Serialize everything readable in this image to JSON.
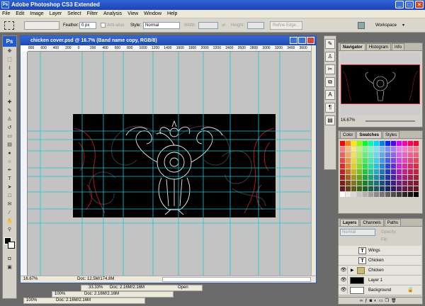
{
  "app": {
    "title": "Adobe Photoshop CS3 Extended",
    "logo": "Ps"
  },
  "menu": [
    "File",
    "Edit",
    "Image",
    "Layer",
    "Select",
    "Filter",
    "Analysis",
    "View",
    "Window",
    "Help"
  ],
  "options": {
    "feather_label": "Feather:",
    "feather_value": "0 px",
    "anti_alias": "Anti-alias",
    "style_label": "Style:",
    "style_value": "Normal",
    "width_label": "Width:",
    "height_label": "Height:",
    "refine_edge": "Refine Edge...",
    "workspace": "Workspace"
  },
  "document": {
    "title": "chicken cover.psd @ 16.7% (Band name copy, RGB/8)",
    "zoom": "16.67%",
    "doc_info": "Doc: 12.5M/174.8M",
    "ruler_ticks": [
      "800",
      "600",
      "400",
      "200",
      "0",
      "200",
      "400",
      "600",
      "800",
      "1000",
      "1200",
      "1400",
      "1600",
      "1800",
      "2000",
      "2200",
      "2400",
      "2600",
      "2800",
      "3000",
      "3200",
      "3400",
      "3600"
    ]
  },
  "minimized_docs": [
    {
      "zoom": "33.33%",
      "doc": "Doc: 2.16M/2.16M",
      "extra": "Open"
    },
    {
      "zoom": "100%",
      "doc": "Doc: 2.16M/2.16M"
    },
    {
      "zoom": "100%",
      "doc": "Doc: 2.16M/2.16M"
    }
  ],
  "navigator": {
    "tabs": [
      "Navigator",
      "Histogram",
      "Info"
    ],
    "zoom": "16.67%"
  },
  "color_panel": {
    "tabs": [
      "Color",
      "Swatches",
      "Styles"
    ]
  },
  "layers_panel": {
    "tabs": [
      "Layers",
      "Channels",
      "Paths"
    ],
    "blend_mode": "Normal",
    "opacity_label": "Opacity:",
    "fill_label": "Fill:",
    "layers": [
      {
        "name": "Wings",
        "kind": "text"
      },
      {
        "name": "Chicken",
        "kind": "text"
      },
      {
        "name": "Chicken",
        "kind": "group"
      },
      {
        "name": "Layer 1",
        "kind": "pixel"
      },
      {
        "name": "Background",
        "kind": "background"
      }
    ]
  },
  "colors": {
    "titlebar": "#1a44b4",
    "canvas_bg": "#c3c3c3",
    "guide": "#19c6d6",
    "art_red": "#b3141f",
    "art_white": "#ffffff"
  },
  "icons": [
    "marquee-icon",
    "move-icon",
    "lasso-icon",
    "magic-wand-icon",
    "crop-icon",
    "eyedropper-icon",
    "brush-icon",
    "stamp-icon",
    "eraser-icon",
    "gradient-icon",
    "pen-icon",
    "type-icon",
    "hand-icon",
    "zoom-icon"
  ]
}
